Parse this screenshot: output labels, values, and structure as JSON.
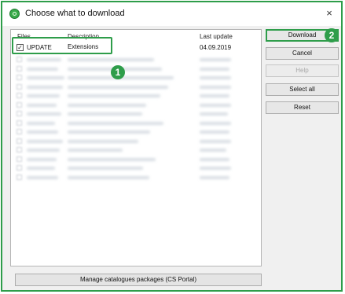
{
  "window": {
    "title": "Choose what to download",
    "app_icon": "green-circle-app-icon",
    "close_symbol": "×"
  },
  "table": {
    "columns": [
      "Files",
      "Description",
      "Last update"
    ],
    "rows": [
      {
        "file": "UPDATE",
        "description": "Extensions",
        "last_update": "04.09.2019",
        "checked": true
      }
    ],
    "blurred_row_count": 14
  },
  "buttons": {
    "download": "Download",
    "cancel": "Cancel",
    "help": "Help",
    "select_all": "Select all",
    "reset": "Reset",
    "manage": "Manage catalogues packages (CS Portal)"
  },
  "annotations": {
    "marker1": "1",
    "marker2": "2",
    "color": "#2e9d4a"
  }
}
